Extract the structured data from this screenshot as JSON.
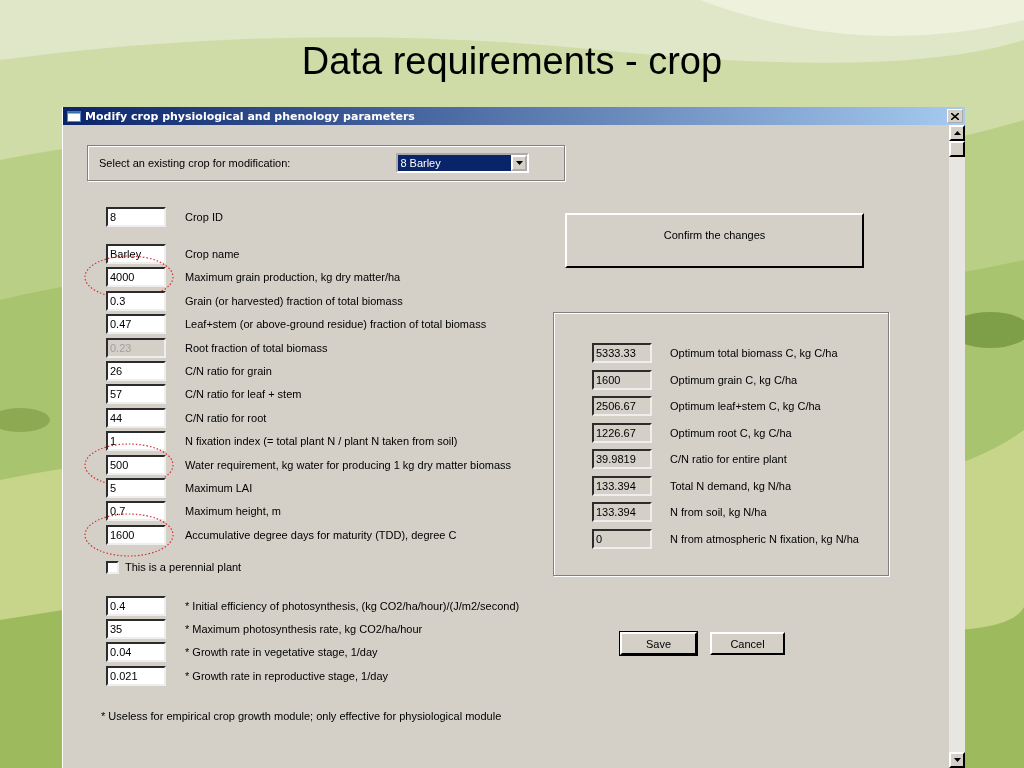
{
  "slide_title": "Data requirements - crop",
  "window": {
    "title": "Modify crop physiological and phenology parameters"
  },
  "crop_selector": {
    "label": "Select an existing crop for modification:",
    "value": "8 Barley"
  },
  "parameters": [
    {
      "value": "8",
      "label": "Crop ID",
      "disabled": false,
      "circled": false
    },
    {
      "value": "Barley",
      "label": "Crop name",
      "disabled": false,
      "circled": false
    },
    {
      "value": "4000",
      "label": "Maximum grain production, kg dry matter/ha",
      "disabled": false,
      "circled": true
    },
    {
      "value": "0.3",
      "label": "Grain (or harvested) fraction of total biomass",
      "disabled": false,
      "circled": false
    },
    {
      "value": "0.47",
      "label": "Leaf+stem (or above-ground residue) fraction of total biomass",
      "disabled": false,
      "circled": false
    },
    {
      "value": "0.23",
      "label": "Root fraction of total biomass",
      "disabled": true,
      "circled": false
    },
    {
      "value": "26",
      "label": "C/N ratio for grain",
      "disabled": false,
      "circled": false
    },
    {
      "value": "57",
      "label": "C/N ratio for leaf + stem",
      "disabled": false,
      "circled": false
    },
    {
      "value": "44",
      "label": "C/N ratio for root",
      "disabled": false,
      "circled": false
    },
    {
      "value": "1",
      "label": "N fixation index (= total plant N / plant N taken from soil)",
      "disabled": false,
      "circled": false
    },
    {
      "value": "500",
      "label": "Water requirement, kg water for producing 1 kg dry matter biomass",
      "disabled": false,
      "circled": true
    },
    {
      "value": "5",
      "label": "Maximum LAI",
      "disabled": false,
      "circled": false
    },
    {
      "value": "0.7",
      "label": "Maximum height, m",
      "disabled": false,
      "circled": false
    },
    {
      "value": "1600",
      "label": "Accumulative degree days for maturity (TDD), degree C",
      "disabled": false,
      "circled": true
    }
  ],
  "perennial": {
    "label": "This is a perennial plant",
    "checked": false
  },
  "photosynthesis_parameters": [
    {
      "value": "0.4",
      "label": "* Initial efficiency of photosynthesis, (kg CO2/ha/hour)/(J/m2/second)"
    },
    {
      "value": "35",
      "label": "* Maximum photosynthesis rate, kg CO2/ha/hour"
    },
    {
      "value": "0.04",
      "label": "* Growth rate in vegetative stage, 1/day"
    },
    {
      "value": "0.021",
      "label": "* Growth rate in reproductive stage, 1/day"
    }
  ],
  "footnote": "* Useless for empirical crop growth module; only effective for physiological module",
  "confirm_button": "Confirm the changes",
  "results": [
    {
      "value": "5333.33",
      "label": "Optimum total biomass C, kg C/ha"
    },
    {
      "value": "1600",
      "label": "Optimum grain C, kg C/ha"
    },
    {
      "value": "2506.67",
      "label": "Optimum leaf+stem C, kg C/ha"
    },
    {
      "value": "1226.67",
      "label": "Optimum root C, kg C/ha"
    },
    {
      "value": "39.9819",
      "label": "C/N ratio for entire plant"
    },
    {
      "value": "133.394",
      "label": "Total N demand, kg N/ha"
    },
    {
      "value": "133.394",
      "label": "N from soil, kg N/ha"
    },
    {
      "value": "0",
      "label": "N from atmospheric N fixation, kg N/ha"
    }
  ],
  "buttons": [
    {
      "label": "Save",
      "default": true
    },
    {
      "label": "Cancel",
      "default": false
    }
  ]
}
